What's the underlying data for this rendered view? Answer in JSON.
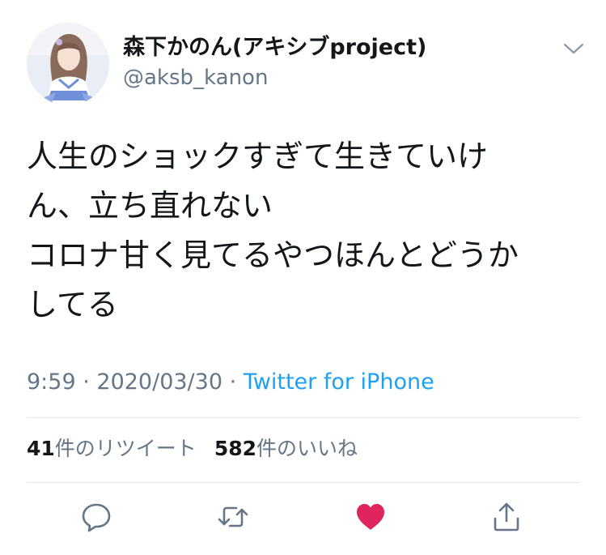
{
  "author": {
    "display_name": "森下かのん(アキシブproject)",
    "handle": "@aksb_kanon"
  },
  "tweet": {
    "lines": [
      "人生のショックすぎて生きていけ",
      "ん、立ち直れない",
      "コロナ甘く見てるやつほんとどうか",
      "してる"
    ]
  },
  "meta": {
    "time": "9:59",
    "separator": " · ",
    "date": "2020/03/30",
    "source": "Twitter for iPhone"
  },
  "stats": {
    "retweets_count": "41",
    "retweets_label": "件のリツイート",
    "likes_count": "582",
    "likes_label": "件のいいね"
  },
  "icons": {
    "menu": "chevron-down-icon",
    "reply": "reply-icon",
    "retweet": "retweet-icon",
    "like": "heart-icon",
    "share": "share-icon"
  },
  "colors": {
    "text": "#14171a",
    "secondary": "#657786",
    "link": "#1da1f2",
    "like": "#e0245e",
    "divider": "#e1e8ed",
    "icon": "#657786"
  }
}
